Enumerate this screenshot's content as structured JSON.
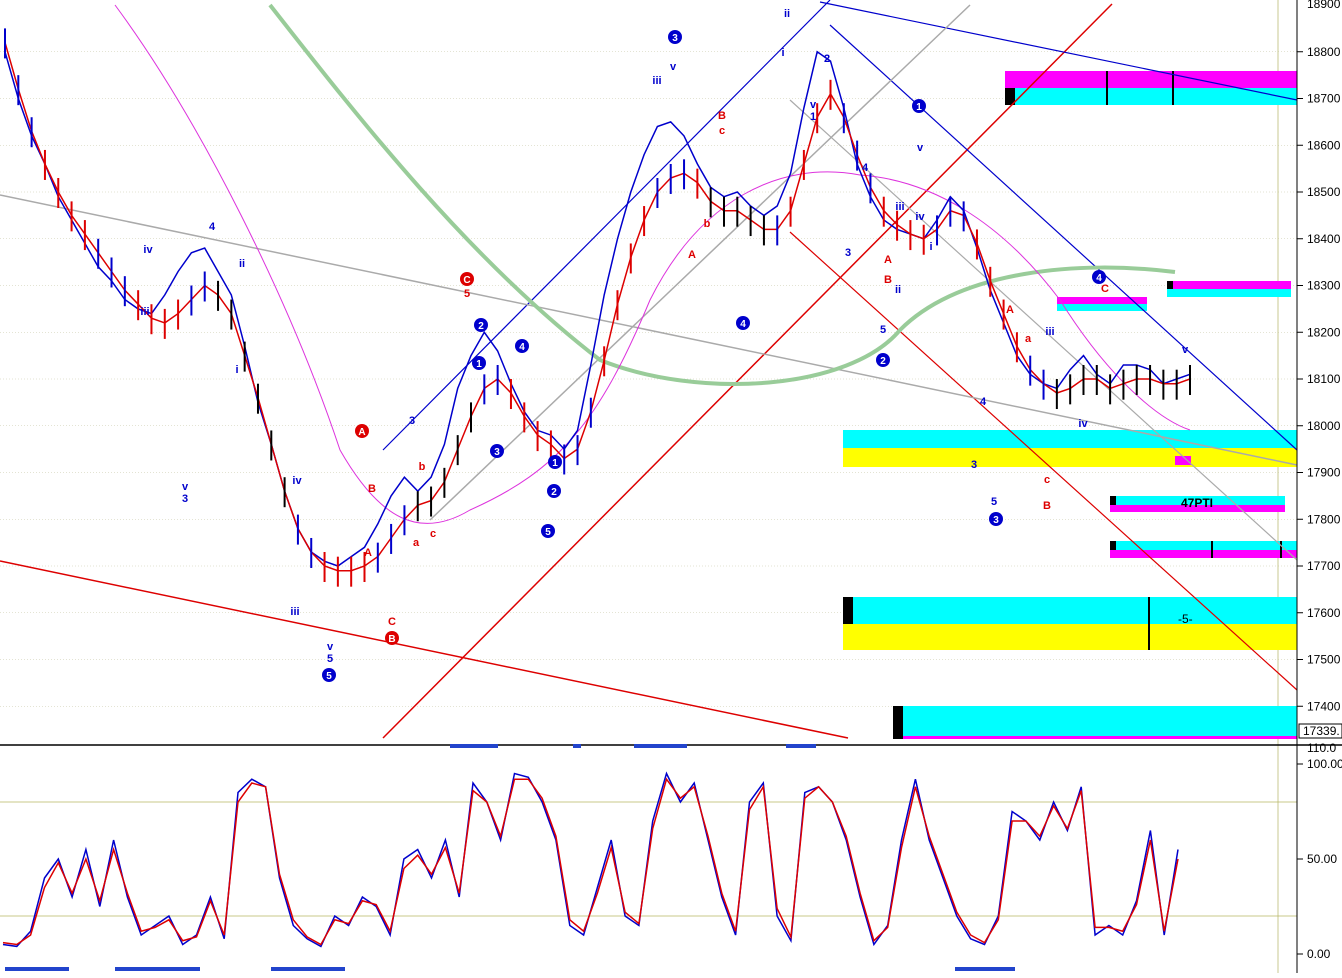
{
  "chart_data": [
    {
      "type": "line",
      "panel": "price",
      "y_ticks": [
        17400,
        17500,
        17600,
        17700,
        17800,
        17900,
        18000,
        18100,
        18200,
        18300,
        18400,
        18500,
        18600,
        18700,
        18800
      ],
      "ylim": [
        17330,
        18910
      ],
      "top_partial_label": "18900",
      "last_price_label": "17339.",
      "annotation_text": "47PTI",
      "annotation_text_2": "-5-",
      "series": [
        {
          "color": "#0000cc",
          "values": [
            18800,
            18700,
            18620,
            18560,
            18490,
            18440,
            18390,
            18340,
            18310,
            18270,
            18250,
            18240,
            18280,
            18330,
            18370,
            18380,
            18330,
            18280,
            18170,
            18050,
            17960,
            17860,
            17780,
            17730,
            17710,
            17700,
            17720,
            17740,
            17790,
            17850,
            17890,
            17860,
            17890,
            17960,
            18080,
            18150,
            18200,
            18160,
            18090,
            18030,
            17990,
            17980,
            17950,
            17990,
            18130,
            18280,
            18400,
            18500,
            18580,
            18640,
            18650,
            18620,
            18560,
            18510,
            18490,
            18500,
            18470,
            18450,
            18470,
            18540,
            18680,
            18800,
            18780,
            18680,
            18560,
            18490,
            18440,
            18420,
            18410,
            18400,
            18440,
            18490,
            18460,
            18380,
            18290,
            18220,
            18150,
            18110,
            18090,
            18080,
            18120,
            18150,
            18110,
            18090,
            18130,
            18130,
            18120,
            18090,
            18100,
            18110
          ]
        },
        {
          "color": "#dd0000",
          "values": [
            18820,
            18720,
            18630,
            18560,
            18500,
            18450,
            18410,
            18370,
            18330,
            18290,
            18260,
            18230,
            18220,
            18240,
            18270,
            18300,
            18280,
            18240,
            18150,
            18060,
            17960,
            17860,
            17780,
            17730,
            17700,
            17690,
            17690,
            17700,
            17720,
            17760,
            17800,
            17830,
            17840,
            17880,
            17950,
            18020,
            18080,
            18100,
            18070,
            18020,
            17980,
            17960,
            17930,
            17950,
            18030,
            18140,
            18260,
            18360,
            18440,
            18500,
            18530,
            18540,
            18520,
            18480,
            18460,
            18460,
            18440,
            18420,
            18420,
            18460,
            18560,
            18660,
            18710,
            18660,
            18580,
            18510,
            18460,
            18430,
            18410,
            18400,
            18420,
            18460,
            18450,
            18390,
            18310,
            18240,
            18170,
            18120,
            18090,
            18070,
            18080,
            18100,
            18100,
            18080,
            18090,
            18100,
            18100,
            18090,
            18090,
            18100
          ]
        }
      ],
      "wave_labels": [
        {
          "text": "v",
          "color": "#0000cc"
        },
        {
          "text": "3",
          "color": "#0000cc"
        },
        {
          "text": "4",
          "color": "#0000cc"
        },
        {
          "text": "iv",
          "color": "#0000cc"
        },
        {
          "text": "iii",
          "color": "#0000cc"
        },
        {
          "text": "ii",
          "color": "#0000cc"
        },
        {
          "text": "i",
          "color": "#0000cc"
        },
        {
          "text": "iv",
          "color": "#0000cc"
        },
        {
          "text": "iii",
          "color": "#0000cc"
        },
        {
          "text": "v",
          "color": "#0000cc"
        },
        {
          "text": "5",
          "color": "#0000cc"
        },
        {
          "text": "A",
          "color": "#dd0000"
        },
        {
          "text": "B",
          "color": "#dd0000"
        },
        {
          "text": "C",
          "color": "#dd0000"
        },
        {
          "text": "b",
          "color": "#dd0000"
        },
        {
          "text": "a",
          "color": "#dd0000"
        },
        {
          "text": "c",
          "color": "#dd0000"
        },
        {
          "text": "3",
          "color": "#0000cc"
        },
        {
          "text": "5",
          "color": "#dd0000"
        },
        {
          "text": "iii",
          "color": "#0000cc"
        },
        {
          "text": "v",
          "color": "#0000cc"
        },
        {
          "text": "ii",
          "color": "#0000cc"
        },
        {
          "text": "i",
          "color": "#0000cc"
        },
        {
          "text": "B",
          "color": "#dd0000"
        },
        {
          "text": "c",
          "color": "#dd0000"
        },
        {
          "text": "b",
          "color": "#dd0000"
        },
        {
          "text": "A",
          "color": "#dd0000"
        },
        {
          "text": "v",
          "color": "#0000cc"
        },
        {
          "text": "1",
          "color": "#0000cc"
        },
        {
          "text": "2",
          "color": "#0000cc"
        },
        {
          "text": "4",
          "color": "#0000cc"
        },
        {
          "text": "3",
          "color": "#0000cc"
        },
        {
          "text": "v",
          "color": "#0000cc"
        },
        {
          "text": "iii",
          "color": "#0000cc"
        },
        {
          "text": "iv",
          "color": "#0000cc"
        },
        {
          "text": "i",
          "color": "#0000cc"
        },
        {
          "text": "ii",
          "color": "#0000cc"
        },
        {
          "text": "A",
          "color": "#dd0000"
        },
        {
          "text": "B",
          "color": "#dd0000"
        },
        {
          "text": "5",
          "color": "#0000cc"
        },
        {
          "text": "3",
          "color": "#0000cc"
        },
        {
          "text": "4",
          "color": "#0000cc"
        },
        {
          "text": "5",
          "color": "#0000cc"
        },
        {
          "text": "A",
          "color": "#dd0000"
        },
        {
          "text": "a",
          "color": "#dd0000"
        },
        {
          "text": "B",
          "color": "#dd0000"
        },
        {
          "text": "c",
          "color": "#dd0000"
        },
        {
          "text": "iii",
          "color": "#0000cc"
        },
        {
          "text": "iv",
          "color": "#0000cc"
        },
        {
          "text": "C",
          "color": "#dd0000"
        },
        {
          "text": "v",
          "color": "#0000cc"
        }
      ],
      "circled_labels": [
        {
          "text": "5",
          "color": "#0000cc"
        },
        {
          "text": "A",
          "color": "#dd0000"
        },
        {
          "text": "B",
          "color": "#dd0000"
        },
        {
          "text": "C",
          "color": "#dd0000"
        },
        {
          "text": "1",
          "color": "#0000cc"
        },
        {
          "text": "2",
          "color": "#0000cc"
        },
        {
          "text": "3",
          "color": "#0000cc"
        },
        {
          "text": "4",
          "color": "#0000cc"
        },
        {
          "text": "5",
          "color": "#0000cc"
        },
        {
          "text": "1",
          "color": "#0000cc"
        },
        {
          "text": "2",
          "color": "#0000cc"
        },
        {
          "text": "3",
          "color": "#0000cc"
        },
        {
          "text": "4",
          "color": "#0000cc"
        },
        {
          "text": "1",
          "color": "#0000cc"
        },
        {
          "text": "2",
          "color": "#0000cc"
        },
        {
          "text": "3",
          "color": "#0000cc"
        },
        {
          "text": "4",
          "color": "#0000cc"
        }
      ],
      "colors": {
        "cyan": "#00ffff",
        "magenta": "#ff00ff",
        "yellow": "#ffff00",
        "green_ma": "#99cc99",
        "purple_ma": "#dd33dd",
        "gray_line": "#aaaaaa",
        "grid": "#c8c8a8"
      }
    },
    {
      "type": "line",
      "panel": "oscillator",
      "y_ticks": [
        0,
        50,
        100
      ],
      "tick_labels": [
        "0.00",
        "50.00",
        "100.00"
      ],
      "top_partial_label": "110.0",
      "ylim": [
        -6,
        110
      ],
      "guides": [
        20,
        80
      ],
      "series": [
        {
          "color": "#0000cc",
          "values": [
            5,
            4,
            12,
            40,
            50,
            30,
            55,
            25,
            60,
            30,
            10,
            15,
            20,
            5,
            10,
            30,
            8,
            85,
            92,
            88,
            40,
            15,
            8,
            4,
            20,
            15,
            30,
            25,
            10,
            50,
            55,
            40,
            60,
            30,
            90,
            80,
            60,
            95,
            93,
            80,
            60,
            15,
            10,
            35,
            60,
            20,
            15,
            70,
            95,
            80,
            90,
            60,
            30,
            10,
            80,
            90,
            20,
            7,
            85,
            88,
            80,
            60,
            30,
            5,
            15,
            60,
            92,
            60,
            40,
            20,
            8,
            5,
            20,
            75,
            70,
            60,
            80,
            65,
            88,
            10,
            15,
            10,
            28,
            65,
            10,
            55
          ]
        },
        {
          "color": "#dd0000",
          "values": [
            6,
            5,
            10,
            35,
            48,
            32,
            50,
            28,
            55,
            32,
            12,
            14,
            18,
            7,
            9,
            28,
            10,
            80,
            90,
            88,
            42,
            18,
            9,
            5,
            18,
            16,
            28,
            26,
            12,
            45,
            52,
            42,
            56,
            32,
            86,
            80,
            62,
            92,
            92,
            82,
            62,
            18,
            12,
            32,
            56,
            22,
            16,
            66,
            92,
            82,
            88,
            62,
            32,
            12,
            76,
            88,
            24,
            9,
            82,
            88,
            80,
            62,
            32,
            7,
            14,
            56,
            88,
            62,
            42,
            22,
            10,
            6,
            18,
            70,
            70,
            62,
            78,
            66,
            86,
            14,
            14,
            12,
            26,
            60,
            12,
            50
          ]
        }
      ]
    }
  ]
}
